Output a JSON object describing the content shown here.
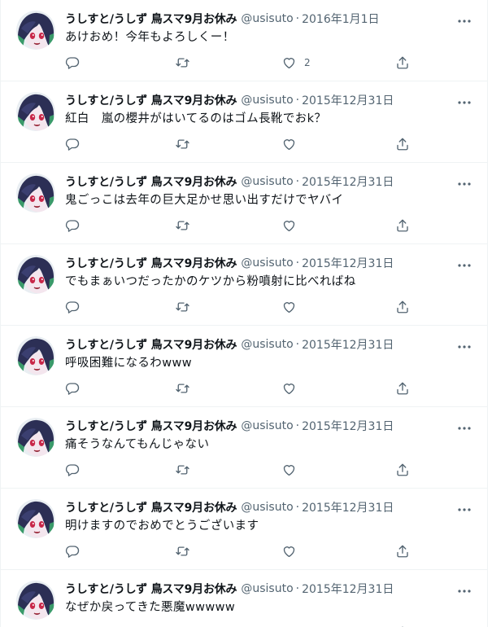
{
  "account": {
    "name": "うしすと/うしず 鳥スマ9月お休み",
    "handle": "@usisuto",
    "separator": "·"
  },
  "colors": {
    "text": "#0f1419",
    "secondary": "#536471",
    "border": "#eff3f4",
    "avatar_accent": "#3a9a6a"
  },
  "icons": {
    "reply": "speech-bubble-icon",
    "retweet": "retweet-arrows-icon",
    "like": "heart-icon",
    "share": "share-upload-icon",
    "more": "three-dots-icon"
  },
  "tweets": [
    {
      "date": "2016年1月1日",
      "text": "あけおめ！今年もよろしくー！",
      "like_count": "2"
    },
    {
      "date": "2015年12月31日",
      "text": "紅白　嵐の櫻井がはいてるのはゴム長靴でおk？",
      "like_count": ""
    },
    {
      "date": "2015年12月31日",
      "text": "鬼ごっこは去年の巨大足かせ思い出すだけでヤバイ",
      "like_count": ""
    },
    {
      "date": "2015年12月31日",
      "text": "でもまぁいつだったかのケツから粉噴射に比べればね",
      "like_count": ""
    },
    {
      "date": "2015年12月31日",
      "text": "呼吸困難になるわwww",
      "like_count": ""
    },
    {
      "date": "2015年12月31日",
      "text": "痛そうなんてもんじゃない",
      "like_count": ""
    },
    {
      "date": "2015年12月31日",
      "text": "明けますのでおめでとうございます",
      "like_count": ""
    },
    {
      "date": "2015年12月31日",
      "text": "なぜか戻ってきた悪魔wwwww",
      "like_count": ""
    }
  ]
}
